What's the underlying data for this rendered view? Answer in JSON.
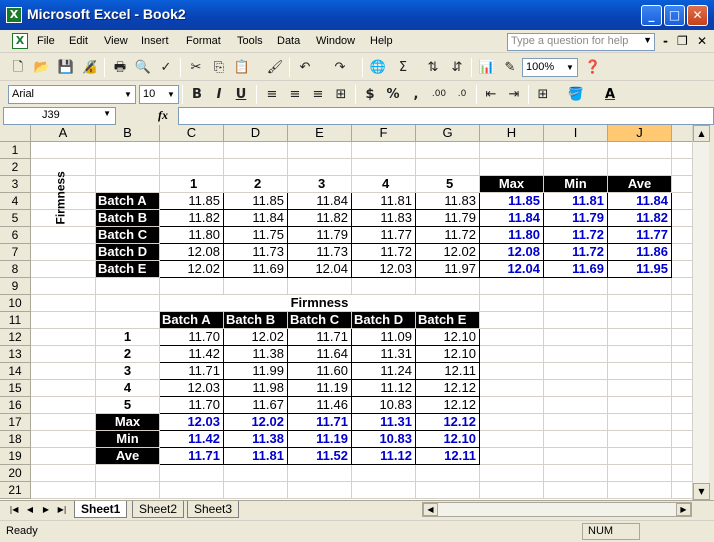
{
  "window": {
    "title": "Microsoft Excel - Book2"
  },
  "menu": [
    "File",
    "Edit",
    "View",
    "Insert",
    "Format",
    "Tools",
    "Data",
    "Window",
    "Help"
  ],
  "ask_placeholder": "Type a question for help",
  "toolbar": {
    "zoom": "100%",
    "font": "Arial",
    "size": "10"
  },
  "formula_bar": {
    "name_box": "J39",
    "fx": "fx",
    "formula": ""
  },
  "columns": [
    "A",
    "B",
    "C",
    "D",
    "E",
    "F",
    "G",
    "H",
    "I",
    "J"
  ],
  "selected_column": "J",
  "rows": [
    "1",
    "2",
    "3",
    "4",
    "5",
    "6",
    "7",
    "8",
    "9",
    "10",
    "11",
    "12",
    "13",
    "14",
    "15",
    "16",
    "17",
    "18",
    "19",
    "20",
    "21"
  ],
  "table1": {
    "vertical_label": "Firmness",
    "headers": [
      "1",
      "2",
      "3",
      "4",
      "5"
    ],
    "stat_headers": [
      "Max",
      "Min",
      "Ave"
    ],
    "rows": [
      {
        "label": "Batch A",
        "values": [
          "11.85",
          "11.85",
          "11.84",
          "11.81",
          "11.83"
        ],
        "stats": [
          "11.85",
          "11.81",
          "11.84"
        ]
      },
      {
        "label": "Batch B",
        "values": [
          "11.82",
          "11.84",
          "11.82",
          "11.83",
          "11.79"
        ],
        "stats": [
          "11.84",
          "11.79",
          "11.82"
        ]
      },
      {
        "label": "Batch C",
        "values": [
          "11.80",
          "11.75",
          "11.79",
          "11.77",
          "11.72"
        ],
        "stats": [
          "11.80",
          "11.72",
          "11.77"
        ]
      },
      {
        "label": "Batch D",
        "values": [
          "12.08",
          "11.73",
          "11.73",
          "11.72",
          "12.02"
        ],
        "stats": [
          "12.08",
          "11.72",
          "11.86"
        ]
      },
      {
        "label": "Batch E",
        "values": [
          "12.02",
          "11.69",
          "12.04",
          "12.03",
          "11.97"
        ],
        "stats": [
          "12.04",
          "11.69",
          "11.95"
        ]
      }
    ]
  },
  "table2": {
    "title": "Firmness",
    "headers": [
      "Batch A",
      "Batch B",
      "Batch C",
      "Batch D",
      "Batch E"
    ],
    "rows": [
      {
        "label": "1",
        "values": [
          "11.70",
          "12.02",
          "11.71",
          "11.09",
          "12.10"
        ]
      },
      {
        "label": "2",
        "values": [
          "11.42",
          "11.38",
          "11.64",
          "11.31",
          "12.10"
        ]
      },
      {
        "label": "3",
        "values": [
          "11.71",
          "11.99",
          "11.60",
          "11.24",
          "12.11"
        ]
      },
      {
        "label": "4",
        "values": [
          "12.03",
          "11.98",
          "11.19",
          "11.12",
          "12.12"
        ]
      },
      {
        "label": "5",
        "values": [
          "11.70",
          "11.67",
          "11.46",
          "10.83",
          "12.12"
        ]
      }
    ],
    "stats": [
      {
        "label": "Max",
        "values": [
          "12.03",
          "12.02",
          "11.71",
          "11.31",
          "12.12"
        ]
      },
      {
        "label": "Min",
        "values": [
          "11.42",
          "11.38",
          "11.19",
          "10.83",
          "12.10"
        ]
      },
      {
        "label": "Ave",
        "values": [
          "11.71",
          "11.81",
          "11.52",
          "11.12",
          "12.11"
        ]
      }
    ]
  },
  "sheets": [
    "Sheet1",
    "Sheet2",
    "Sheet3"
  ],
  "active_sheet": "Sheet1",
  "status": {
    "left": "Ready",
    "num": "NUM"
  },
  "colors": {
    "title_bar": "#0842b4",
    "header_fill": "#000000",
    "stat_text": "#0000cc",
    "selected_col": "#ffc873"
  }
}
